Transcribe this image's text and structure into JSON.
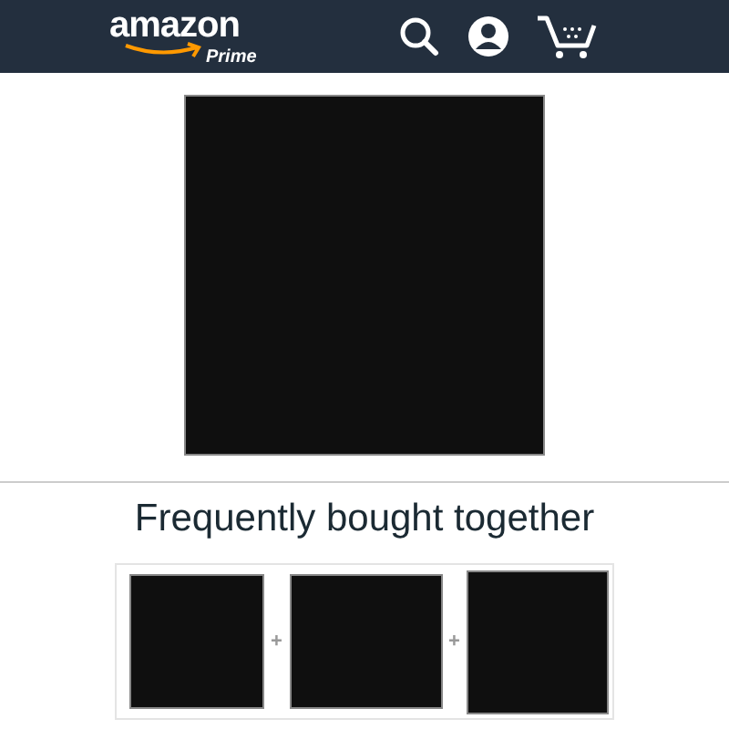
{
  "header": {
    "logo": "amazon",
    "sublogo": "Prime"
  },
  "main_image": {
    "kind": "picture"
  },
  "section": {
    "title": "Frequently bought together",
    "products": [
      {
        "kind": "picture"
      },
      {
        "kind": "picture"
      },
      {
        "kind": "picture"
      }
    ],
    "separators": [
      "+",
      "+"
    ]
  }
}
